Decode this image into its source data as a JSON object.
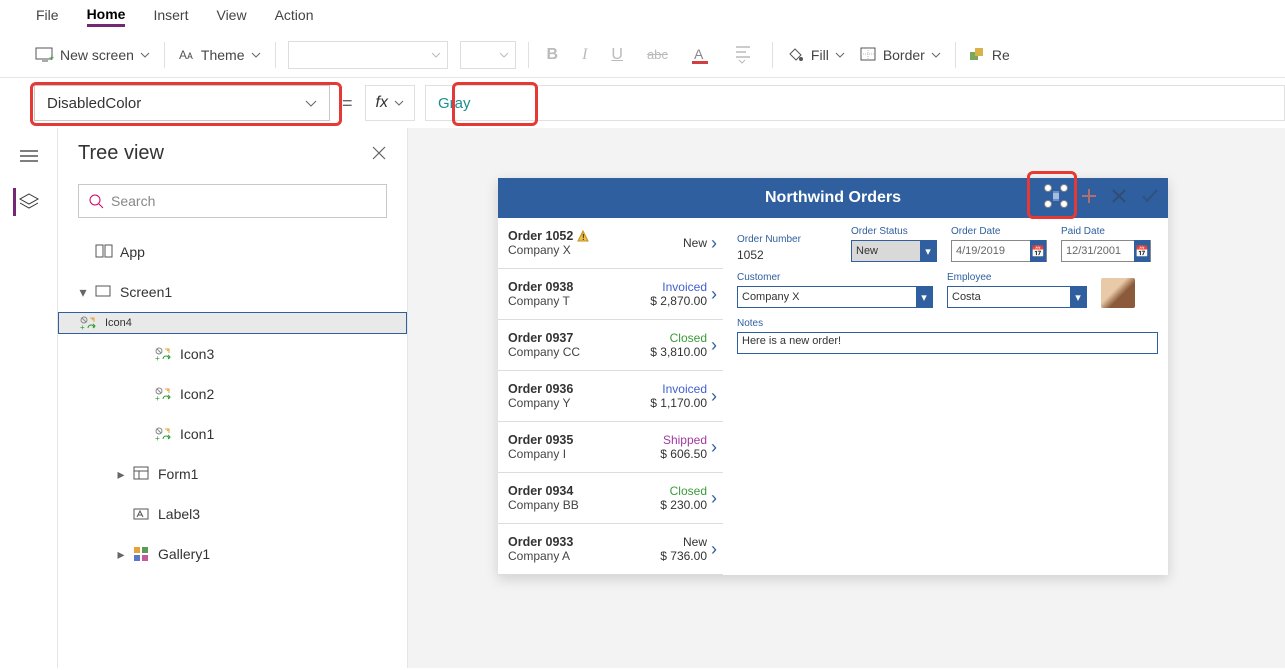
{
  "menu": {
    "items": [
      "File",
      "Home",
      "Insert",
      "View",
      "Action"
    ],
    "active": "Home"
  },
  "toolbar": {
    "new_screen": "New screen",
    "theme": "Theme",
    "fill": "Fill",
    "border": "Border",
    "reorder_short": "Re"
  },
  "property_selector": "DisabledColor",
  "formula_value": "Gray",
  "panel": {
    "title": "Tree view",
    "search_placeholder": "Search"
  },
  "tree": {
    "app": "App",
    "screen": "Screen1",
    "items": [
      {
        "label": "Icon4",
        "selected": true
      },
      {
        "label": "Icon3"
      },
      {
        "label": "Icon2"
      },
      {
        "label": "Icon1"
      },
      {
        "label": "Form1",
        "caret": true,
        "type": "form"
      },
      {
        "label": "Label3",
        "type": "label"
      },
      {
        "label": "Gallery1",
        "caret": true,
        "type": "gallery"
      }
    ]
  },
  "preview": {
    "title": "Northwind Orders",
    "orders": [
      {
        "title": "Order 1052",
        "warn": true,
        "company": "Company X",
        "status": "New",
        "statusClass": "",
        "amount": ""
      },
      {
        "title": "Order 0938",
        "company": "Company T",
        "status": "Invoiced",
        "statusClass": "c-blue",
        "amount": "$ 2,870.00"
      },
      {
        "title": "Order 0937",
        "company": "Company CC",
        "status": "Closed",
        "statusClass": "c-green",
        "amount": "$ 3,810.00"
      },
      {
        "title": "Order 0936",
        "company": "Company Y",
        "status": "Invoiced",
        "statusClass": "c-blue",
        "amount": "$ 1,170.00"
      },
      {
        "title": "Order 0935",
        "company": "Company I",
        "status": "Shipped",
        "statusClass": "c-purple",
        "amount": "$ 606.50"
      },
      {
        "title": "Order 0934",
        "company": "Company BB",
        "status": "Closed",
        "statusClass": "c-green",
        "amount": "$ 230.00"
      },
      {
        "title": "Order 0933",
        "company": "Company A",
        "status": "New",
        "statusClass": "",
        "amount": "$ 736.00"
      }
    ],
    "detail": {
      "labels": {
        "order_number": "Order Number",
        "order_status": "Order Status",
        "order_date": "Order Date",
        "paid_date": "Paid Date",
        "customer": "Customer",
        "employee": "Employee",
        "notes": "Notes"
      },
      "order_number": "1052",
      "order_status": "New",
      "order_date": "4/19/2019",
      "paid_date": "12/31/2001",
      "customer": "Company X",
      "employee": "Costa",
      "notes": "Here is a new order!"
    }
  }
}
